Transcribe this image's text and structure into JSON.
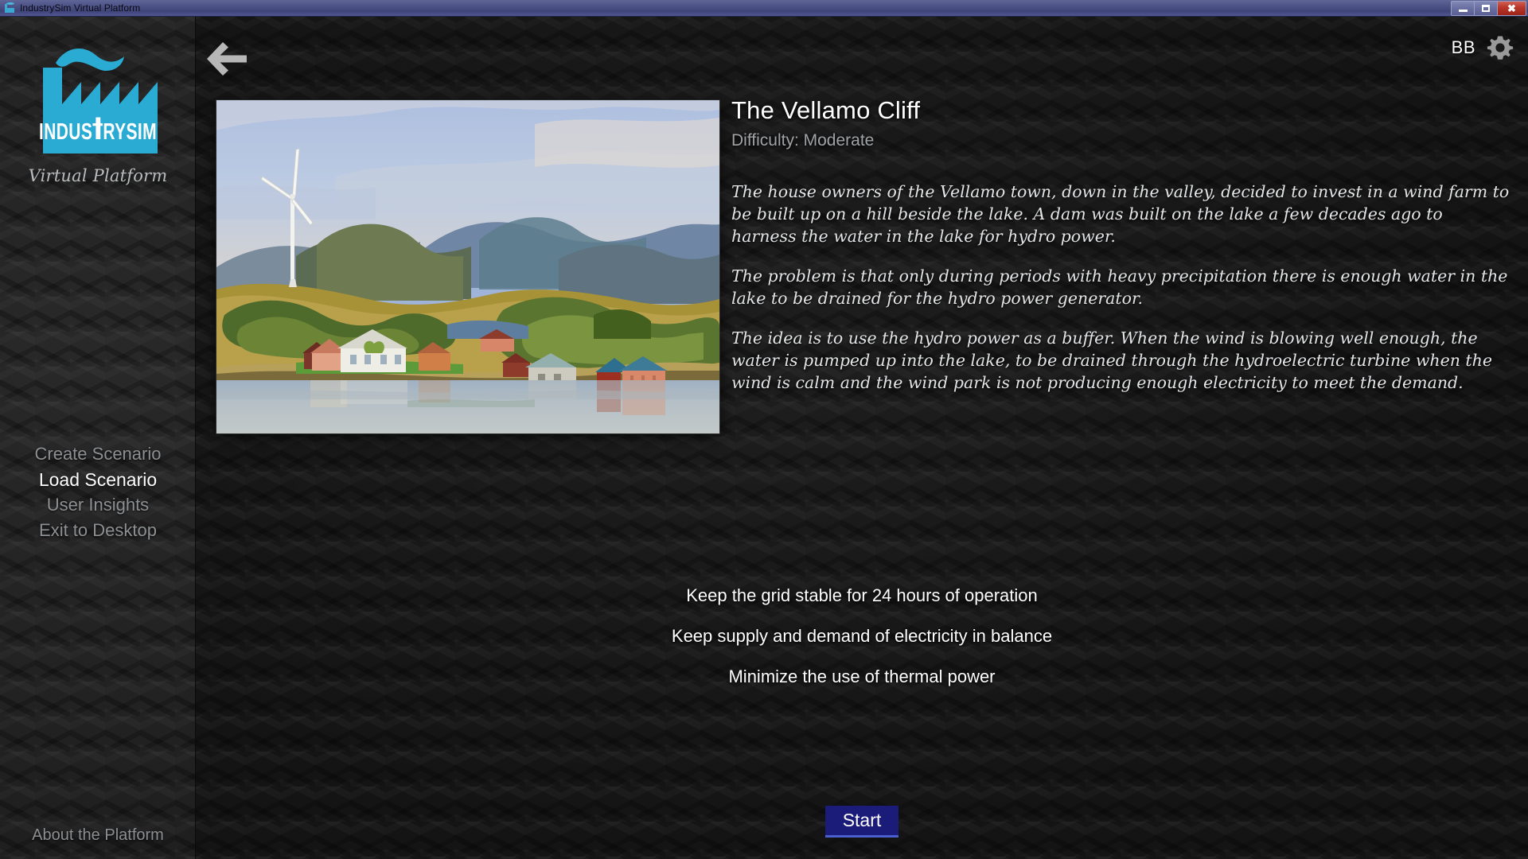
{
  "window": {
    "title": "IndustrySim Virtual Platform",
    "icon": "factory-icon",
    "controls": {
      "minimize": "minimize-icon",
      "maximize": "maximize-icon",
      "close": "close-icon"
    }
  },
  "sidebar": {
    "logo": {
      "name": "IndustrySim",
      "mark": "factory-logo-icon",
      "tagline": "Virtual Platform",
      "accent_color": "#29ABD4"
    },
    "menu": [
      {
        "label": "Create Scenario",
        "active": false
      },
      {
        "label": "Load Scenario",
        "active": true
      },
      {
        "label": "User Insights",
        "active": false
      },
      {
        "label": "Exit to Desktop",
        "active": false
      }
    ],
    "about_label": "About the Platform"
  },
  "header": {
    "back_icon": "back-arrow-icon",
    "user_initials": "BB",
    "settings_icon": "gear-icon"
  },
  "scenario": {
    "image_alt": "Painted landscape of a coastal village with a wind turbine on a hill beside a lake",
    "title": "The Vellamo Cliff",
    "difficulty": "Difficulty: Moderate",
    "description": [
      "The house owners of the Vellamo town, down in the valley, decided to invest in a wind farm to be built up on a hill beside the lake. A dam was built on the lake a few decades ago to harness the water in the lake for hydro power.",
      "The problem is that only during periods with heavy precipitation there is enough water in the lake to be drained for the hydro power generator.",
      "The idea is to use the hydro power as a buffer. When the wind is blowing well enough, the water is pumped up into the lake, to be drained through the hydroelectric turbine when the wind is calm and the wind park is not producing enough electricity to meet the demand."
    ],
    "objectives": [
      "Keep the grid stable for 24 hours of operation",
      "Keep supply and demand of electricity in balance",
      "Minimize the use of thermal power"
    ]
  },
  "actions": {
    "start_label": "Start",
    "start_bg_color": "#1B1B7A",
    "start_underline_color": "#4A5FD0"
  }
}
